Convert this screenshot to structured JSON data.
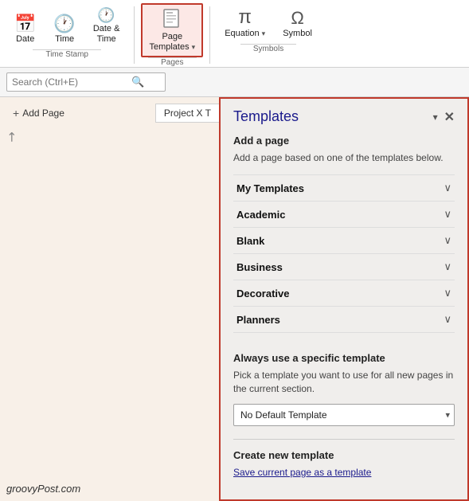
{
  "ribbon": {
    "groups": [
      {
        "name": "timestamp",
        "label": "Time Stamp",
        "buttons": [
          {
            "id": "date",
            "label": "Date",
            "icon": "📅"
          },
          {
            "id": "time",
            "label": "Time",
            "icon": "🕐"
          },
          {
            "id": "datetime",
            "label": "Date &\nTime",
            "icon": "🕐"
          }
        ]
      },
      {
        "name": "pages",
        "label": "Pages",
        "buttons": [
          {
            "id": "page-templates",
            "label": "Page\nTemplates",
            "icon": "📄",
            "active": true,
            "has_dropdown": true
          }
        ]
      },
      {
        "name": "symbols",
        "label": "Symbols",
        "buttons": [
          {
            "id": "equation",
            "label": "Equation",
            "icon": "π",
            "has_dropdown": true
          },
          {
            "id": "symbol",
            "label": "Symbol",
            "icon": "Ω"
          }
        ]
      }
    ]
  },
  "search": {
    "placeholder": "Search (Ctrl+E)"
  },
  "left_panel": {
    "add_page_label": "+ Add Page",
    "page_tab_label": "Project X T",
    "expand_icon": "↗"
  },
  "templates_panel": {
    "title": "Templates",
    "add_page_heading": "Add a page",
    "add_page_desc": "Add a page based on one of the templates below.",
    "template_items": [
      {
        "label": "My Templates"
      },
      {
        "label": "Academic"
      },
      {
        "label": "Blank"
      },
      {
        "label": "Business"
      },
      {
        "label": "Decorative"
      },
      {
        "label": "Planners"
      }
    ],
    "always_heading": "Always use a specific template",
    "always_desc": "Pick a template you want to use for all new pages in the current section.",
    "dropdown_default": "No Default Template",
    "dropdown_options": [
      "No Default Template"
    ],
    "create_heading": "Create new template",
    "save_link_label": "Save current page as a template"
  },
  "watermark": "groovyPost.com"
}
